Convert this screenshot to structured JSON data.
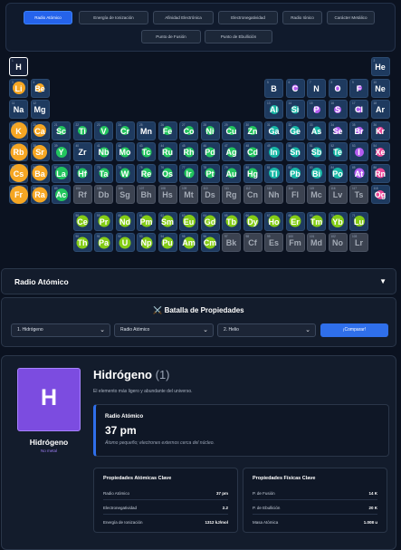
{
  "tabs": [
    {
      "label": "Radio Atómico",
      "active": true
    },
    {
      "label": "Energía de Ionización"
    },
    {
      "label": "Afinidad Electrónica"
    },
    {
      "label": "Electronegatividad"
    },
    {
      "label": "Radio Iónico"
    },
    {
      "label": "Carácter Metálico"
    },
    {
      "label": "Punto de Fusión"
    },
    {
      "label": "Punto de Ebullición"
    }
  ],
  "elements": [
    {
      "z": 1,
      "s": "H",
      "r": 1,
      "c": 1,
      "dot": 0,
      "dc": "none",
      "sel": true
    },
    {
      "z": 2,
      "s": "He",
      "r": 1,
      "c": 18,
      "dot": 0,
      "dc": "none"
    },
    {
      "z": 3,
      "s": "Li",
      "r": 2,
      "c": 1,
      "dot": 14,
      "dc": "orange"
    },
    {
      "z": 4,
      "s": "Be",
      "r": 2,
      "c": 2,
      "dot": 10,
      "dc": "orange"
    },
    {
      "z": 5,
      "s": "B",
      "r": 2,
      "c": 13,
      "dot": 0,
      "dc": "none"
    },
    {
      "z": 6,
      "s": "C",
      "r": 2,
      "c": 14,
      "dot": 7,
      "dc": "purple"
    },
    {
      "z": 7,
      "s": "N",
      "r": 2,
      "c": 15,
      "dot": 0,
      "dc": "none"
    },
    {
      "z": 8,
      "s": "O",
      "r": 2,
      "c": 16,
      "dot": 6,
      "dc": "purple"
    },
    {
      "z": 9,
      "s": "F",
      "r": 2,
      "c": 17,
      "dot": 6,
      "dc": "purple"
    },
    {
      "z": 10,
      "s": "Ne",
      "r": 2,
      "c": 18,
      "dot": 0,
      "dc": "none"
    },
    {
      "z": 11,
      "s": "Na",
      "r": 3,
      "c": 1,
      "dot": 0,
      "dc": "none"
    },
    {
      "z": 12,
      "s": "Mg",
      "r": 3,
      "c": 2,
      "dot": 0,
      "dc": "none"
    },
    {
      "z": 13,
      "s": "Al",
      "r": 3,
      "c": 13,
      "dot": 10,
      "dc": "teal"
    },
    {
      "z": 14,
      "s": "Si",
      "r": 3,
      "c": 14,
      "dot": 9,
      "dc": "teal"
    },
    {
      "z": 15,
      "s": "P",
      "r": 3,
      "c": 15,
      "dot": 8,
      "dc": "purple"
    },
    {
      "z": 16,
      "s": "S",
      "r": 3,
      "c": 16,
      "dot": 8,
      "dc": "purple"
    },
    {
      "z": 17,
      "s": "Cl",
      "r": 3,
      "c": 17,
      "dot": 7,
      "dc": "purple"
    },
    {
      "z": 18,
      "s": "Ar",
      "r": 3,
      "c": 18,
      "dot": 0,
      "dc": "none"
    },
    {
      "z": 19,
      "s": "K",
      "r": 4,
      "c": 1,
      "dot": 18,
      "dc": "orange"
    },
    {
      "z": 20,
      "s": "Ca",
      "r": 4,
      "c": 2,
      "dot": 14,
      "dc": "orange"
    },
    {
      "z": 21,
      "s": "Sc",
      "r": 4,
      "c": 3,
      "dot": 10,
      "dc": "green"
    },
    {
      "z": 22,
      "s": "Ti",
      "r": 4,
      "c": 4,
      "dot": 10,
      "dc": "green"
    },
    {
      "z": 23,
      "s": "V",
      "r": 4,
      "c": 5,
      "dot": 10,
      "dc": "green"
    },
    {
      "z": 24,
      "s": "Cr",
      "r": 4,
      "c": 6,
      "dot": 10,
      "dc": "green"
    },
    {
      "z": 25,
      "s": "Mn",
      "r": 4,
      "c": 7,
      "dot": 0,
      "dc": "none"
    },
    {
      "z": 26,
      "s": "Fe",
      "r": 4,
      "c": 8,
      "dot": 10,
      "dc": "green"
    },
    {
      "z": 27,
      "s": "Co",
      "r": 4,
      "c": 9,
      "dot": 10,
      "dc": "green"
    },
    {
      "z": 28,
      "s": "Ni",
      "r": 4,
      "c": 10,
      "dot": 10,
      "dc": "green"
    },
    {
      "z": 29,
      "s": "Cu",
      "r": 4,
      "c": 11,
      "dot": 10,
      "dc": "green"
    },
    {
      "z": 30,
      "s": "Zn",
      "r": 4,
      "c": 12,
      "dot": 10,
      "dc": "green"
    },
    {
      "z": 31,
      "s": "Ga",
      "r": 4,
      "c": 13,
      "dot": 10,
      "dc": "teal"
    },
    {
      "z": 32,
      "s": "Ge",
      "r": 4,
      "c": 14,
      "dot": 10,
      "dc": "teal"
    },
    {
      "z": 33,
      "s": "As",
      "r": 4,
      "c": 15,
      "dot": 9,
      "dc": "teal"
    },
    {
      "z": 34,
      "s": "Se",
      "r": 4,
      "c": 16,
      "dot": 8,
      "dc": "purple"
    },
    {
      "z": 35,
      "s": "Br",
      "r": 4,
      "c": 17,
      "dot": 8,
      "dc": "purple"
    },
    {
      "z": 36,
      "s": "Kr",
      "r": 4,
      "c": 18,
      "dot": 8,
      "dc": "pink"
    },
    {
      "z": 37,
      "s": "Rb",
      "r": 5,
      "c": 1,
      "dot": 19,
      "dc": "orange"
    },
    {
      "z": 38,
      "s": "Sr",
      "r": 5,
      "c": 2,
      "dot": 16,
      "dc": "orange"
    },
    {
      "z": 39,
      "s": "Y",
      "r": 5,
      "c": 3,
      "dot": 12,
      "dc": "green"
    },
    {
      "z": 40,
      "s": "Zr",
      "r": 5,
      "c": 4,
      "dot": 0,
      "dc": "none"
    },
    {
      "z": 41,
      "s": "Nb",
      "r": 5,
      "c": 5,
      "dot": 11,
      "dc": "green"
    },
    {
      "z": 42,
      "s": "Mo",
      "r": 5,
      "c": 6,
      "dot": 11,
      "dc": "green"
    },
    {
      "z": 43,
      "s": "Tc",
      "r": 5,
      "c": 7,
      "dot": 11,
      "dc": "green"
    },
    {
      "z": 44,
      "s": "Ru",
      "r": 5,
      "c": 8,
      "dot": 11,
      "dc": "green"
    },
    {
      "z": 45,
      "s": "Rh",
      "r": 5,
      "c": 9,
      "dot": 11,
      "dc": "green"
    },
    {
      "z": 46,
      "s": "Pd",
      "r": 5,
      "c": 10,
      "dot": 11,
      "dc": "green"
    },
    {
      "z": 47,
      "s": "Ag",
      "r": 5,
      "c": 11,
      "dot": 11,
      "dc": "green"
    },
    {
      "z": 48,
      "s": "Cd",
      "r": 5,
      "c": 12,
      "dot": 11,
      "dc": "green"
    },
    {
      "z": 49,
      "s": "In",
      "r": 5,
      "c": 13,
      "dot": 12,
      "dc": "teal"
    },
    {
      "z": 50,
      "s": "Sn",
      "r": 5,
      "c": 14,
      "dot": 11,
      "dc": "teal"
    },
    {
      "z": 51,
      "s": "Sb",
      "r": 5,
      "c": 15,
      "dot": 11,
      "dc": "teal"
    },
    {
      "z": 52,
      "s": "Te",
      "r": 5,
      "c": 16,
      "dot": 10,
      "dc": "teal"
    },
    {
      "z": 53,
      "s": "I",
      "r": 5,
      "c": 17,
      "dot": 10,
      "dc": "purple"
    },
    {
      "z": 54,
      "s": "Xe",
      "r": 5,
      "c": 18,
      "dot": 10,
      "dc": "pink"
    },
    {
      "z": 55,
      "s": "Cs",
      "r": 6,
      "c": 1,
      "dot": 20,
      "dc": "orange"
    },
    {
      "z": 56,
      "s": "Ba",
      "r": 6,
      "c": 2,
      "dot": 17,
      "dc": "orange"
    },
    {
      "z": 57,
      "s": "La",
      "r": 6,
      "c": 3,
      "dot": 14,
      "dc": "green"
    },
    {
      "z": 72,
      "s": "Hf",
      "r": 6,
      "c": 4,
      "dot": 11,
      "dc": "green"
    },
    {
      "z": 73,
      "s": "Ta",
      "r": 6,
      "c": 5,
      "dot": 11,
      "dc": "green"
    },
    {
      "z": 74,
      "s": "W",
      "r": 6,
      "c": 6,
      "dot": 11,
      "dc": "green"
    },
    {
      "z": 75,
      "s": "Re",
      "r": 6,
      "c": 7,
      "dot": 11,
      "dc": "green"
    },
    {
      "z": 76,
      "s": "Os",
      "r": 6,
      "c": 8,
      "dot": 11,
      "dc": "green"
    },
    {
      "z": 77,
      "s": "Ir",
      "r": 6,
      "c": 9,
      "dot": 11,
      "dc": "green"
    },
    {
      "z": 78,
      "s": "Pt",
      "r": 6,
      "c": 10,
      "dot": 11,
      "dc": "green"
    },
    {
      "z": 79,
      "s": "Au",
      "r": 6,
      "c": 11,
      "dot": 11,
      "dc": "green"
    },
    {
      "z": 80,
      "s": "Hg",
      "r": 6,
      "c": 12,
      "dot": 11,
      "dc": "green"
    },
    {
      "z": 81,
      "s": "Tl",
      "r": 6,
      "c": 13,
      "dot": 12,
      "dc": "teal"
    },
    {
      "z": 82,
      "s": "Pb",
      "r": 6,
      "c": 14,
      "dot": 12,
      "dc": "teal"
    },
    {
      "z": 83,
      "s": "Bi",
      "r": 6,
      "c": 15,
      "dot": 12,
      "dc": "teal"
    },
    {
      "z": 84,
      "s": "Po",
      "r": 6,
      "c": 16,
      "dot": 12,
      "dc": "teal"
    },
    {
      "z": 85,
      "s": "At",
      "r": 6,
      "c": 17,
      "dot": 11,
      "dc": "purple"
    },
    {
      "z": 86,
      "s": "Rn",
      "r": 6,
      "c": 18,
      "dot": 11,
      "dc": "pink"
    },
    {
      "z": 87,
      "s": "Fr",
      "r": 7,
      "c": 1,
      "dot": 20,
      "dc": "orange"
    },
    {
      "z": 88,
      "s": "Ra",
      "r": 7,
      "c": 2,
      "dot": 17,
      "dc": "orange"
    },
    {
      "z": 89,
      "s": "Ac",
      "r": 7,
      "c": 3,
      "dot": 14,
      "dc": "green"
    },
    {
      "z": 104,
      "s": "Rf",
      "r": 7,
      "c": 4,
      "dot": 0,
      "dc": "none",
      "syn": true
    },
    {
      "z": 105,
      "s": "Db",
      "r": 7,
      "c": 5,
      "dot": 0,
      "dc": "none",
      "syn": true
    },
    {
      "z": 106,
      "s": "Sg",
      "r": 7,
      "c": 6,
      "dot": 0,
      "dc": "none",
      "syn": true
    },
    {
      "z": 107,
      "s": "Bh",
      "r": 7,
      "c": 7,
      "dot": 0,
      "dc": "none",
      "syn": true
    },
    {
      "z": 108,
      "s": "Hs",
      "r": 7,
      "c": 8,
      "dot": 0,
      "dc": "none",
      "syn": true
    },
    {
      "z": 109,
      "s": "Mt",
      "r": 7,
      "c": 9,
      "dot": 0,
      "dc": "none",
      "syn": true
    },
    {
      "z": 110,
      "s": "Ds",
      "r": 7,
      "c": 10,
      "dot": 0,
      "dc": "none",
      "syn": true
    },
    {
      "z": 111,
      "s": "Rg",
      "r": 7,
      "c": 11,
      "dot": 0,
      "dc": "none",
      "syn": true
    },
    {
      "z": 112,
      "s": "Cn",
      "r": 7,
      "c": 12,
      "dot": 0,
      "dc": "none",
      "syn": true
    },
    {
      "z": 113,
      "s": "Nh",
      "r": 7,
      "c": 13,
      "dot": 0,
      "dc": "none",
      "syn": true
    },
    {
      "z": 114,
      "s": "Fl",
      "r": 7,
      "c": 14,
      "dot": 0,
      "dc": "none",
      "syn": true
    },
    {
      "z": 115,
      "s": "Mc",
      "r": 7,
      "c": 15,
      "dot": 0,
      "dc": "none",
      "syn": true
    },
    {
      "z": 116,
      "s": "Lv",
      "r": 7,
      "c": 16,
      "dot": 0,
      "dc": "none",
      "syn": true
    },
    {
      "z": 117,
      "s": "Ts",
      "r": 7,
      "c": 17,
      "dot": 0,
      "dc": "none",
      "syn": true
    },
    {
      "z": 118,
      "s": "Og",
      "r": 7,
      "c": 18,
      "dot": 10,
      "dc": "pink"
    },
    {
      "z": 58,
      "s": "Ce",
      "r": 9,
      "c": 4,
      "dot": 13,
      "dc": "lime"
    },
    {
      "z": 59,
      "s": "Pr",
      "r": 9,
      "c": 5,
      "dot": 13,
      "dc": "lime"
    },
    {
      "z": 60,
      "s": "Nd",
      "r": 9,
      "c": 6,
      "dot": 13,
      "dc": "lime"
    },
    {
      "z": 61,
      "s": "Pm",
      "r": 9,
      "c": 7,
      "dot": 13,
      "dc": "lime"
    },
    {
      "z": 62,
      "s": "Sm",
      "r": 9,
      "c": 8,
      "dot": 13,
      "dc": "lime"
    },
    {
      "z": 63,
      "s": "Eu",
      "r": 9,
      "c": 9,
      "dot": 14,
      "dc": "lime"
    },
    {
      "z": 64,
      "s": "Gd",
      "r": 9,
      "c": 10,
      "dot": 13,
      "dc": "lime"
    },
    {
      "z": 65,
      "s": "Tb",
      "r": 9,
      "c": 11,
      "dot": 13,
      "dc": "lime"
    },
    {
      "z": 66,
      "s": "Dy",
      "r": 9,
      "c": 12,
      "dot": 13,
      "dc": "lime"
    },
    {
      "z": 67,
      "s": "Ho",
      "r": 9,
      "c": 13,
      "dot": 13,
      "dc": "lime"
    },
    {
      "z": 68,
      "s": "Er",
      "r": 9,
      "c": 14,
      "dot": 13,
      "dc": "lime"
    },
    {
      "z": 69,
      "s": "Tm",
      "r": 9,
      "c": 15,
      "dot": 13,
      "dc": "lime"
    },
    {
      "z": 70,
      "s": "Yb",
      "r": 9,
      "c": 16,
      "dot": 14,
      "dc": "lime"
    },
    {
      "z": 71,
      "s": "Lu",
      "r": 9,
      "c": 17,
      "dot": 12,
      "dc": "lime"
    },
    {
      "z": 90,
      "s": "Th",
      "r": 10,
      "c": 4,
      "dot": 13,
      "dc": "lime"
    },
    {
      "z": 91,
      "s": "Pa",
      "r": 10,
      "c": 5,
      "dot": 13,
      "dc": "lime"
    },
    {
      "z": 92,
      "s": "U",
      "r": 10,
      "c": 6,
      "dot": 13,
      "dc": "lime"
    },
    {
      "z": 93,
      "s": "Np",
      "r": 10,
      "c": 7,
      "dot": 13,
      "dc": "lime"
    },
    {
      "z": 94,
      "s": "Pu",
      "r": 10,
      "c": 8,
      "dot": 13,
      "dc": "lime"
    },
    {
      "z": 95,
      "s": "Am",
      "r": 10,
      "c": 9,
      "dot": 13,
      "dc": "lime"
    },
    {
      "z": 96,
      "s": "Cm",
      "r": 10,
      "c": 10,
      "dot": 13,
      "dc": "lime"
    },
    {
      "z": 97,
      "s": "Bk",
      "r": 10,
      "c": 11,
      "dot": 0,
      "dc": "none",
      "syn": true
    },
    {
      "z": 98,
      "s": "Cf",
      "r": 10,
      "c": 12,
      "dot": 0,
      "dc": "none",
      "syn": true
    },
    {
      "z": 99,
      "s": "Es",
      "r": 10,
      "c": 13,
      "dot": 0,
      "dc": "none",
      "syn": true
    },
    {
      "z": 100,
      "s": "Fm",
      "r": 10,
      "c": 14,
      "dot": 0,
      "dc": "none",
      "syn": true
    },
    {
      "z": 101,
      "s": "Md",
      "r": 10,
      "c": 15,
      "dot": 0,
      "dc": "none",
      "syn": true
    },
    {
      "z": 102,
      "s": "No",
      "r": 10,
      "c": 16,
      "dot": 0,
      "dc": "none",
      "syn": true
    },
    {
      "z": 103,
      "s": "Lr",
      "r": 10,
      "c": 17,
      "dot": 0,
      "dc": "none",
      "syn": true
    }
  ],
  "dot_colors": {
    "orange": "#f5a623",
    "purple": "#b45cf0",
    "teal": "#17b8a6",
    "green": "#22c55e",
    "pink": "#ec4899",
    "lime": "#84cc16"
  },
  "property_bar": {
    "label": "Radio Atómico",
    "caret": "▼"
  },
  "battle": {
    "title": "⚔️ Batalla de Propiedades",
    "select1": "1. Hidrógeno",
    "select2": "Radio Atómico",
    "select3": "2. Helio",
    "compare": "¡Comparar!"
  },
  "detail": {
    "symbol": "H",
    "name": "Hidrógeno",
    "category": "No metal",
    "title_name": "Hidrógeno",
    "title_num": "(1)",
    "description": "El elemento más ligero y abundante del universo.",
    "prop_label": "Radio Atómico",
    "prop_value": "37 pm",
    "prop_desc": "Átomo pequeño; electrones externos cerca del núcleo.",
    "atomic": {
      "title": "Propiedades Atómicas Clave",
      "rows": [
        {
          "k": "Radio Atómico",
          "v": "37 pm"
        },
        {
          "k": "Electronegatividad",
          "v": "2.2"
        },
        {
          "k": "Energía de Ionización",
          "v": "1312 kJ/mol"
        }
      ]
    },
    "physical": {
      "title": "Propiedades Físicas Clave",
      "rows": [
        {
          "k": "P. de Fusión",
          "v": "14 K"
        },
        {
          "k": "P. de Ebullición",
          "v": "20 K"
        },
        {
          "k": "Masa Atómica",
          "v": "1.008 u"
        }
      ]
    }
  }
}
